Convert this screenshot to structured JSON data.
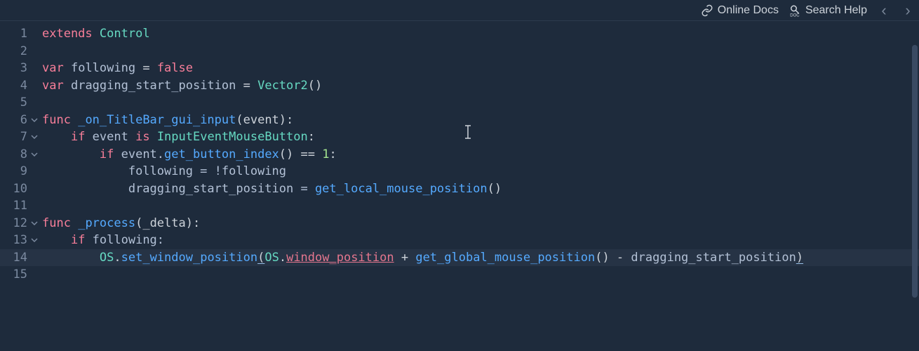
{
  "topbar": {
    "online_docs": "Online Docs",
    "search_help": "Search Help"
  },
  "gutter_lines": [
    "1",
    "2",
    "3",
    "4",
    "5",
    "6",
    "7",
    "8",
    "9",
    "10",
    "11",
    "12",
    "13",
    "14",
    "15"
  ],
  "code_tokens": {
    "l1": {
      "extends": "extends",
      "control": "Control"
    },
    "l3": {
      "var": "var",
      "following": "following",
      "eq": " = ",
      "false": "false"
    },
    "l4": {
      "var": "var",
      "name": "dragging_start_position",
      "eq": " = ",
      "vector2": "Vector2",
      "paren": "()"
    },
    "l6": {
      "func": "func",
      "name": "_on_TitleBar_gui_input",
      "args": "(event):"
    },
    "l7": {
      "if": "if",
      "event": " event ",
      "is": "is",
      "cls": " InputEventMouseButton",
      "colon": ":"
    },
    "l8": {
      "if": "if",
      "txt1": " event.",
      "fn": "get_button_index",
      "paren": "()",
      "eq": " == ",
      "num": "1",
      "colon": ":"
    },
    "l9": {
      "txt": "following = !following"
    },
    "l10": {
      "txt1": "dragging_start_position = ",
      "fn": "get_local_mouse_position",
      "paren": "()"
    },
    "l12": {
      "func": "func",
      "name": "_process",
      "args": "(_delta):"
    },
    "l13": {
      "if": "if",
      "txt": " following:"
    },
    "l14": {
      "os": "OS",
      "dot1": ".",
      "setfn": "set_window_position",
      "lp": "(",
      "os2": "OS",
      "dot2": ".",
      "winpos": "window_position",
      "plus": " + ",
      "getfn": "get_global_mouse_position",
      "paren": "()",
      "minus": " - ",
      "tail": "dragging_start_position",
      "rp": ")"
    }
  }
}
